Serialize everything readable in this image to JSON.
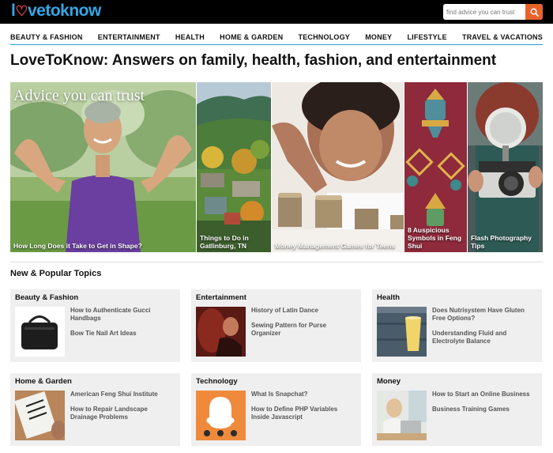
{
  "header": {
    "logo_a": "l",
    "logo_b": "vetoknow",
    "search_placeholder": "find advice you can trust"
  },
  "nav": [
    "BEAUTY & FASHION",
    "ENTERTAINMENT",
    "HEALTH",
    "HOME & GARDEN",
    "TECHNOLOGY",
    "MONEY",
    "LIFESTYLE",
    "TRAVEL & VACATIONS"
  ],
  "page_title": "LoveToKnow: Answers on family, health, fashion, and entertainment",
  "hero": {
    "tagline": "Advice you can trust",
    "tiles": [
      {
        "caption": "How Long Does it Take to Get in Shape?"
      },
      {
        "caption": "Things to Do in Gatlinburg, TN"
      },
      {
        "caption": "Money Management Games for Teens"
      },
      {
        "caption": "8 Auspicious Symbols in Feng Shui"
      },
      {
        "caption": "Flash Photography Tips"
      }
    ]
  },
  "section_title": "New & Popular Topics",
  "topics": [
    {
      "title": "Beauty & Fashion",
      "links": [
        "How to Authenticate Gucci Handbags",
        "Bow Tie Nail Art Ideas"
      ]
    },
    {
      "title": "Entertainment",
      "links": [
        "History of Latin Dance",
        "Sewing Pattern for Purse Organizer"
      ]
    },
    {
      "title": "Health",
      "links": [
        "Does Nutrisystem Have Gluten Free Options?",
        "Understanding Fluid and Electrolyte Balance"
      ]
    },
    {
      "title": "Home & Garden",
      "links": [
        "American Feng Shui Institute",
        "How to Repair Landscape Drainage Problems"
      ]
    },
    {
      "title": "Technology",
      "links": [
        "What Is Snapchat?",
        "How to Define PHP Variables Inside Javascript"
      ]
    },
    {
      "title": "Money",
      "links": [
        "How to Start an Online Business",
        "Business Training Games"
      ]
    }
  ],
  "colors": {
    "accent_blue": "#2a9fd6",
    "search_orange": "#e8632b",
    "logo_red": "#e2424a"
  }
}
